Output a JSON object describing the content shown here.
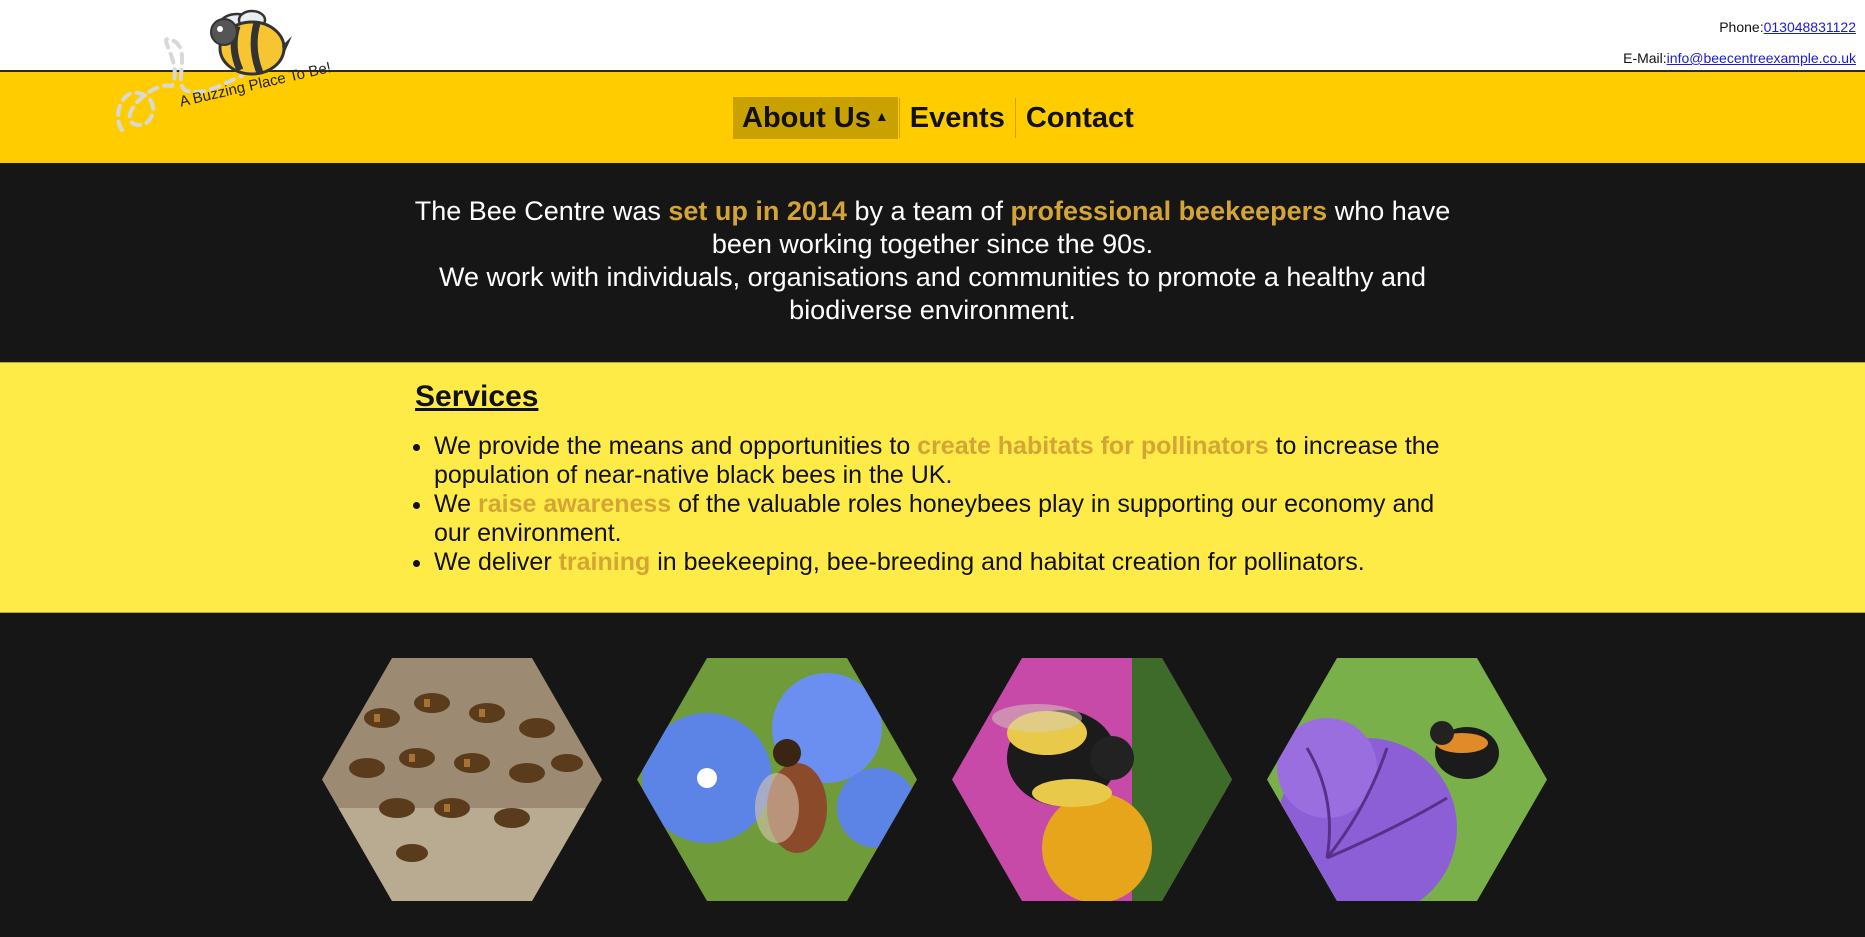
{
  "header": {
    "phone_label": "Phone:",
    "phone_value": "013048831122",
    "email_label": "E-Mail:",
    "email_value": "info@beecentreexample.co.uk",
    "logo_tagline": "A Buzzing Place To Be!"
  },
  "nav": {
    "items": [
      {
        "label": "About Us",
        "active": true
      },
      {
        "label": "Events"
      },
      {
        "label": "Contact"
      }
    ],
    "active_indicator": "caret-up-icon"
  },
  "intro": {
    "p1_a": "The Bee Centre was ",
    "p1_hl1": "set up in 2014",
    "p1_b": " by a team of ",
    "p1_hl2": "professional beekeepers",
    "p1_c": " who have been working together since the 90s.",
    "p2": "We work with individuals, organisations and communities to promote a healthy and biodiverse environment."
  },
  "services": {
    "title": "Services",
    "items": [
      {
        "a": "We provide the means and opportunities to ",
        "hl": "create habitats for pollinators",
        "b": " to increase the population of near-native black bees in the UK."
      },
      {
        "a": "We ",
        "hl": "raise awareness",
        "b": " of the valuable roles honeybees play in supporting our economy and our environment."
      },
      {
        "a": "We deliver ",
        "hl": "training",
        "b": " in beekeeping, bee-breeding and habitat creation for pollinators."
      }
    ]
  },
  "gallery": {
    "images": [
      "honeybees-on-wood",
      "bee-on-blue-flower",
      "bumblebee-on-pink-flower",
      "bumblebee-with-purple-flower"
    ]
  },
  "colors": {
    "brand_yellow": "#ffcc00",
    "services_yellow": "#ffeb47",
    "highlight": "#d4a535",
    "dark": "#161616"
  }
}
